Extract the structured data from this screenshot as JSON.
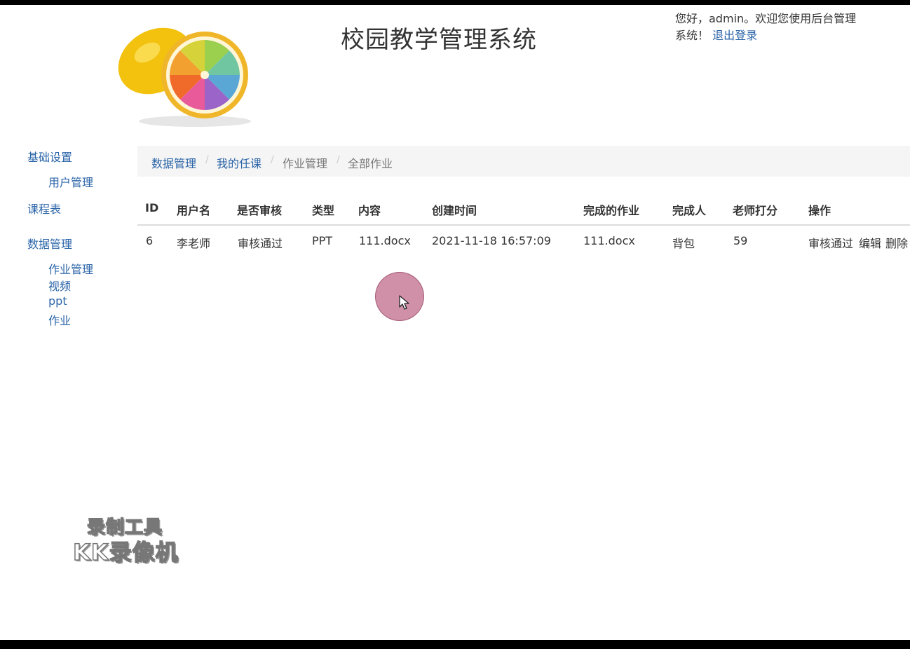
{
  "header": {
    "title": "校园教学管理系统",
    "greeting_prefix": "您好，admin。欢迎您使用后台管理",
    "greeting_suffix": "系统！",
    "logout_label": "退出登录"
  },
  "sidebar": {
    "groups": [
      {
        "label": "基础设置",
        "items": [
          "用户管理"
        ]
      },
      {
        "label": "课程表",
        "items": []
      },
      {
        "label": "数据管理",
        "items": [
          "作业管理",
          "视频",
          "ppt",
          "作业"
        ]
      }
    ]
  },
  "breadcrumb": [
    "数据管理",
    "我的任课",
    "作业管理",
    "全部作业"
  ],
  "breadcrumb_separator": "/",
  "table": {
    "headers": [
      "ID",
      "用户名",
      "是否审核",
      "类型",
      "内容",
      "创建时间",
      "完成的作业",
      "完成人",
      "老师打分",
      "操作"
    ],
    "rows": [
      {
        "id": "6",
        "username": "李老师",
        "review_status": "审核通过",
        "type": "PPT",
        "content": "111.docx",
        "created_at": "2021-11-18 16:57:09",
        "finished_work": "111.docx",
        "finisher": "背包",
        "score": "59",
        "actions": [
          "审核通过",
          "编辑",
          "删除"
        ]
      }
    ]
  },
  "watermark": {
    "line1": "录制工具",
    "line2": "KK录像机"
  },
  "colors": {
    "link": "#2a64a8",
    "breadcrumb_bg": "#f5f5f5",
    "cursor_highlight": "#b0466e"
  }
}
